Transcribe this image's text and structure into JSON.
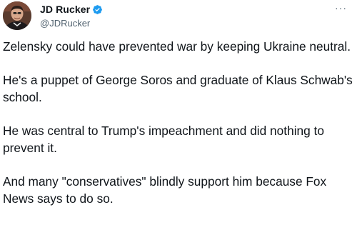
{
  "author": {
    "name": "JD Rucker",
    "handle": "@JDRucker",
    "verified": true,
    "verified_color": "#1d9bf0"
  },
  "icons": {
    "more": "more-options-icon",
    "verified": "verified-badge-icon",
    "avatar": "profile-avatar"
  },
  "more_label": "···",
  "tweet": {
    "p1": "Zelensky could have prevented war by keeping Ukraine neutral.",
    "p2": "He's a puppet of George Soros and graduate of Klaus Schwab's school.",
    "p3": "He was central to Trump's impeachment and did nothing to prevent it.",
    "p4": "And many \"conservatives\" blindly support him because Fox News says to do so."
  }
}
